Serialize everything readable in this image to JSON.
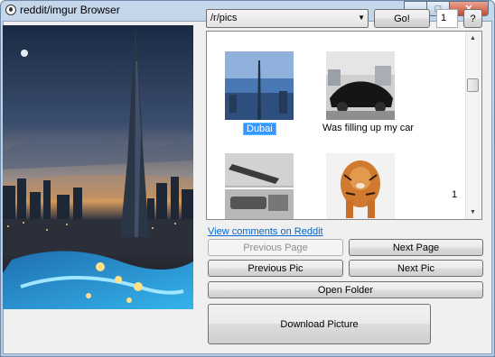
{
  "window": {
    "title": "reddit/imgur Browser",
    "icon": "reddit-alien-icon"
  },
  "controls": {
    "subreddit_value": "/r/pics",
    "go_label": "Go!",
    "page_value": "1",
    "help_label": "?"
  },
  "gallery": {
    "items": [
      {
        "caption": "Dubai",
        "selected": true
      },
      {
        "caption": "Was filling up my car",
        "selected": false
      },
      {
        "caption": "",
        "selected": false
      },
      {
        "caption": "",
        "selected": false
      }
    ],
    "page_number": "1"
  },
  "actions": {
    "view_comments": "View comments on Reddit",
    "previous_page": "Previous Page",
    "next_page": "Next Page",
    "previous_pic": "Previous Pic",
    "next_pic": "Next Pic",
    "open_folder": "Open Folder",
    "download": "Download Picture"
  },
  "colors": {
    "selection": "#3399ff",
    "link": "#0066cc"
  }
}
